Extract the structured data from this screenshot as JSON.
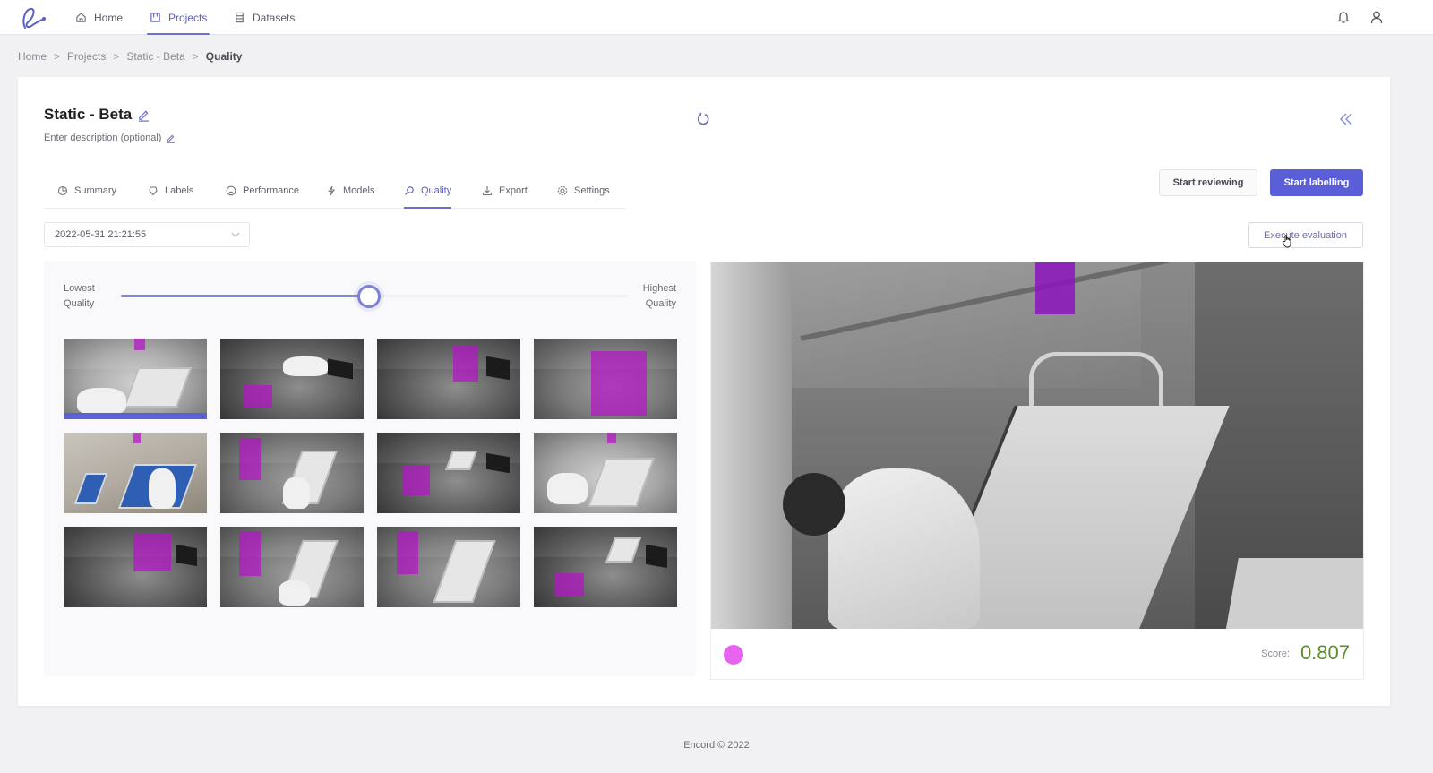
{
  "nav": {
    "items": [
      {
        "label": "Home",
        "icon": "home-icon",
        "active": false
      },
      {
        "label": "Projects",
        "icon": "project-board-icon",
        "active": true
      },
      {
        "label": "Datasets",
        "icon": "database-icon",
        "active": false
      }
    ],
    "right_icons": [
      "bell-icon",
      "user-icon"
    ]
  },
  "breadcrumb": {
    "items": [
      "Home",
      "Projects",
      "Static - Beta"
    ],
    "current": "Quality",
    "separator": ">"
  },
  "project": {
    "title": "Static - Beta",
    "description_placeholder": "Enter description (optional)"
  },
  "tabs": [
    {
      "label": "Summary",
      "icon": "pie-chart-icon",
      "active": false
    },
    {
      "label": "Labels",
      "icon": "tag-icon",
      "active": false
    },
    {
      "label": "Performance",
      "icon": "gauge-icon",
      "active": false
    },
    {
      "label": "Models",
      "icon": "lightning-icon",
      "active": false
    },
    {
      "label": "Quality",
      "icon": "search-icon",
      "active": true
    },
    {
      "label": "Export",
      "icon": "download-icon",
      "active": false
    },
    {
      "label": "Settings",
      "icon": "gear-icon",
      "active": false
    }
  ],
  "actions": {
    "start_reviewing": "Start reviewing",
    "start_labelling": "Start labelling",
    "execute_evaluation": "Execute evaluation"
  },
  "date_select": {
    "value": "2022-05-31 21:21:55"
  },
  "quality_panel": {
    "lowest_label_1": "Lowest",
    "lowest_label_2": "Quality",
    "highest_label_1": "Highest",
    "highest_label_2": "Quality",
    "slider_value": 0.49,
    "thumbnails": [
      {
        "selected": true,
        "has_overlay": true
      },
      {
        "selected": false,
        "has_overlay": true
      },
      {
        "selected": false,
        "has_overlay": true
      },
      {
        "selected": false,
        "has_overlay": true
      },
      {
        "selected": false,
        "has_overlay": true
      },
      {
        "selected": false,
        "has_overlay": true
      },
      {
        "selected": false,
        "has_overlay": true
      },
      {
        "selected": false,
        "has_overlay": true
      },
      {
        "selected": false,
        "has_overlay": true
      },
      {
        "selected": false,
        "has_overlay": true
      },
      {
        "selected": false,
        "has_overlay": true
      },
      {
        "selected": false,
        "has_overlay": true
      }
    ]
  },
  "viewer": {
    "class_color": "#e764f0",
    "score_label": "Score:",
    "score_value": "0.807"
  },
  "colors": {
    "accent": "#5a5fd8",
    "overlay": "#a01ec8",
    "score": "#5f8c2f"
  },
  "footer": {
    "text": "Encord © 2022"
  }
}
